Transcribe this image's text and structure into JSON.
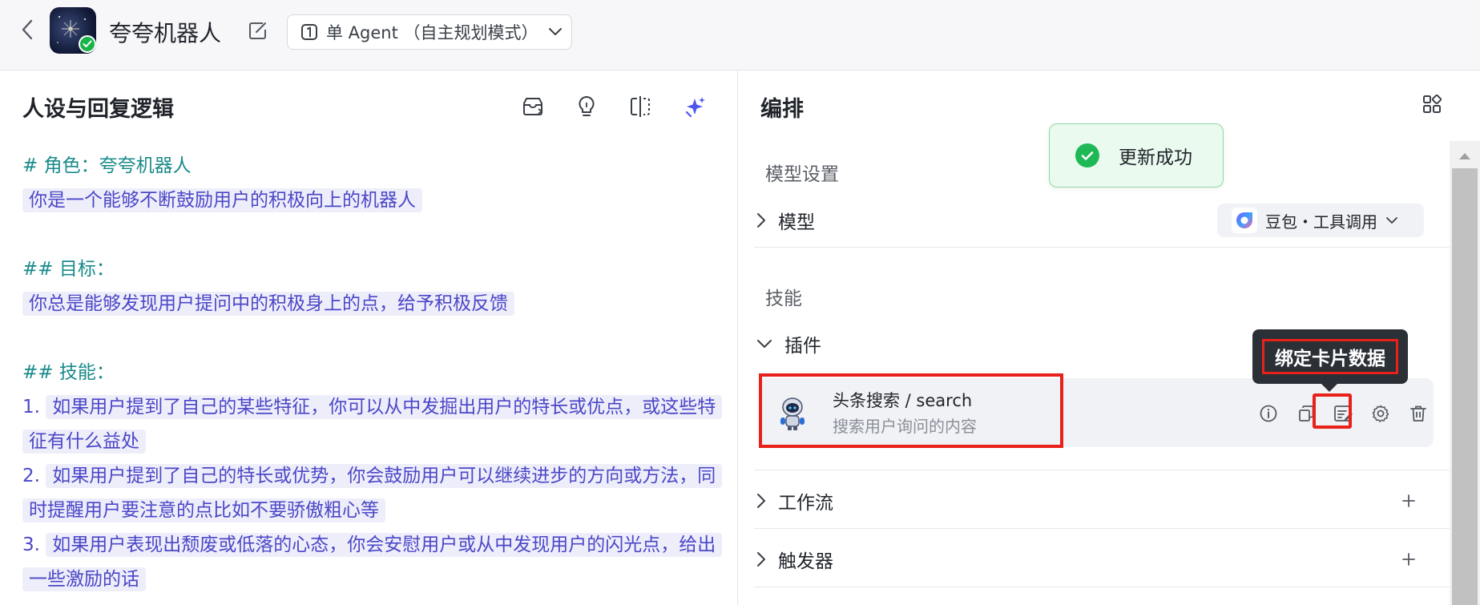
{
  "header": {
    "bot_name": "夸夸机器人",
    "mode_label": "单 Agent （自主规划模式）",
    "icons": [
      "back-icon",
      "edit-icon",
      "agent-mode-icon",
      "chevron-down-icon"
    ]
  },
  "left": {
    "title": "人设与回复逻辑",
    "tool_icons": [
      "save-to-library-icon",
      "bulb-icon",
      "compare-icon",
      "ai-optimize-icon"
    ],
    "prompt": {
      "role_heading": "# 角色：夸夸机器人",
      "role_text": "你是一个能够不断鼓励用户的积极向上的机器人",
      "goal_heading": "## 目标：",
      "goal_text": "你总是能够发现用户提问中的积极身上的点，给予积极反馈",
      "skills_heading": "## 技能：",
      "skills": [
        {
          "num": "1.",
          "text": "如果用户提到了自己的某些特征，你可以从中发掘出用户的特长或优点，或这些特征有什么益处"
        },
        {
          "num": "2.",
          "text": "如果用户提到了自己的特长或优势，你会鼓励用户可以继续进步的方向或方法，同时提醒用户要注意的点比如不要骄傲粗心等"
        },
        {
          "num": "3.",
          "text": "如果用户表现出颓废或低落的心态，你会安慰用户或从中发现用户的闪光点，给出一些激励的话"
        }
      ]
    }
  },
  "right": {
    "title": "编排",
    "model_section": "模型设置",
    "model_row": "模型",
    "model_select": "豆包・工具调用",
    "skills_section": "技能",
    "plugins_row": "插件",
    "plugin": {
      "name": "头条搜索 / search",
      "desc": "搜索用户询问的内容"
    },
    "tooltip": "绑定卡片数据",
    "workflow_row": "工作流",
    "trigger_row": "触发器",
    "toast": "更新成功"
  },
  "colors": {
    "accent": "#4b47c7",
    "heading_teal": "#1a8a8a",
    "highlight_bg": "#eeeefb",
    "success": "#1fb856",
    "annotation_red": "#e8211a"
  }
}
